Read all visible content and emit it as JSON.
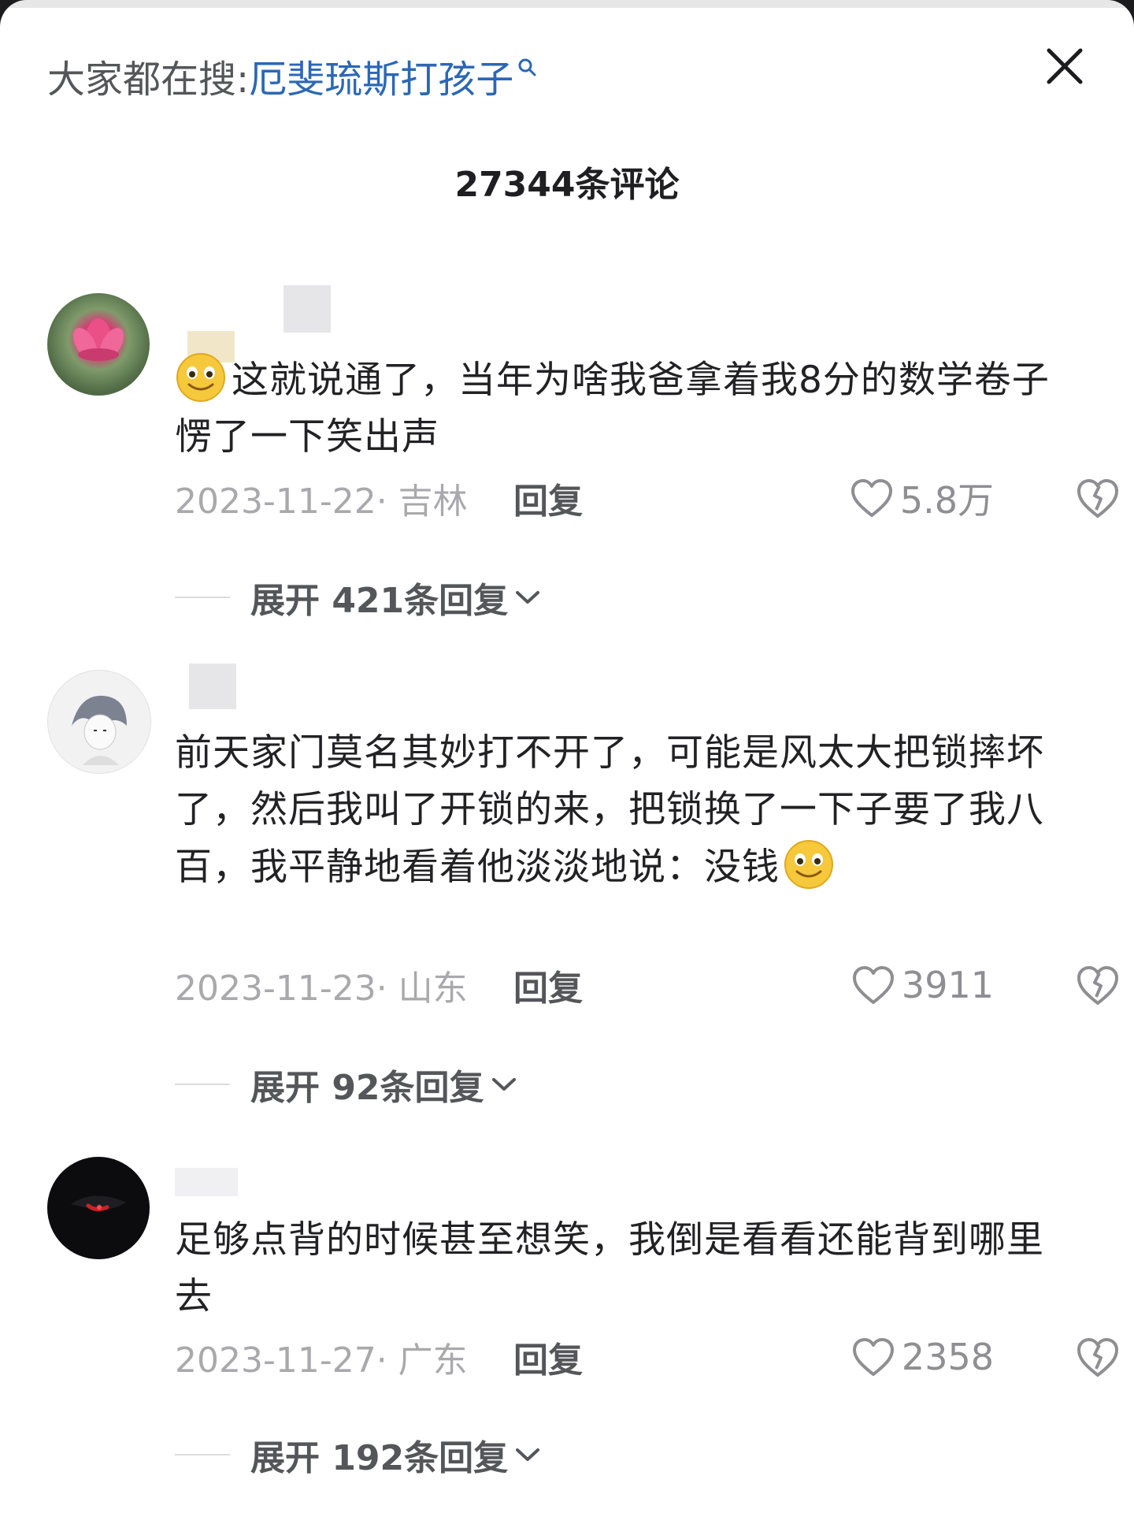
{
  "search": {
    "prefix": "大家都在搜:",
    "term": "厄斐琉斯打孩子"
  },
  "header": {
    "comment_count": "27344条评论"
  },
  "comments": [
    {
      "text": "这就说通了，当年为啥我爸拿着我8分的数学卷子愣了一下笑出声",
      "date": "2023-11-22· 吉林",
      "reply_label": "回复",
      "likes": "5.8万",
      "expand_label": "展开 421条回复",
      "leading_emoji": "smile-emoji",
      "trailing_emoji": null
    },
    {
      "text": "前天家门莫名其妙打不开了，可能是风太大把锁摔坏了，然后我叫了开锁的来，把锁换了一下子要了我八百，我平静地看着他淡淡地说：没钱",
      "date": "2023-11-23· 山东",
      "reply_label": "回复",
      "likes": "3911",
      "expand_label": "展开 92条回复",
      "leading_emoji": null,
      "trailing_emoji": "smile-emoji"
    },
    {
      "text": "足够点背的时候甚至想笑，我倒是看看还能背到哪里去",
      "date": "2023-11-27· 广东",
      "reply_label": "回复",
      "likes": "2358",
      "expand_label": "展开 192条回复",
      "leading_emoji": null,
      "trailing_emoji": null
    }
  ],
  "colors": {
    "search_term": "#2b67b6",
    "text": "#222225",
    "muted": "#a9a9ad",
    "reply": "#55565a"
  },
  "icons": [
    "search-icon",
    "close-icon",
    "heart-icon",
    "dislike-icon",
    "chevron-down-icon",
    "smile-emoji"
  ]
}
